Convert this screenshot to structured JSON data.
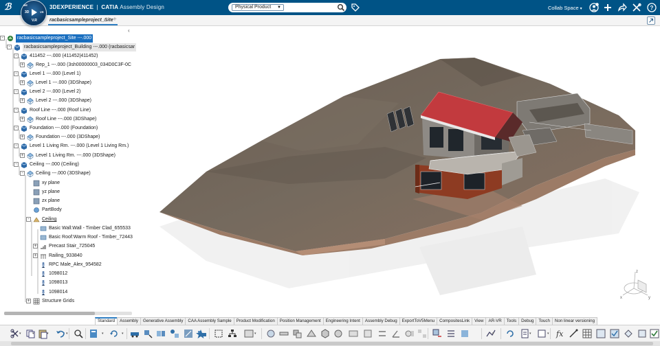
{
  "app": {
    "brand": "3DEXPERIENCE",
    "separator": "|",
    "product": "CATIA",
    "app_name": "Assembly Design",
    "compass": {
      "top": "ME",
      "left": "3D",
      "right": "VR",
      "bottom": "V.R"
    }
  },
  "search": {
    "scope": "Physical Product",
    "placeholder": ""
  },
  "header": {
    "collab_space": "Collab Space"
  },
  "tabs": {
    "document": "racbasicsampleproject_Site",
    "close": "×",
    "add": "+"
  },
  "tree": {
    "collapse_glyph": "‹",
    "items": [
      {
        "label": "racbasicsampleproject_Site ---.000"
      },
      {
        "label": "racbasicsampleproject_Building ---.000 (racbasicsar"
      },
      {
        "label": "411452 ---.000 (411452|411452)"
      },
      {
        "label": "Rep_1 ---.000 (3sh00000003_034D0C3F-0C"
      },
      {
        "label": "Level 1 ---.000 (Level 1)"
      },
      {
        "label": "Level 1 ---.000 (3DShape)"
      },
      {
        "label": "Level 2 ---.000 (Level 2)"
      },
      {
        "label": "Level 2 ---.000 (3DShape)"
      },
      {
        "label": "Roof Line ---.000 (Roof Line)"
      },
      {
        "label": "Roof Line ---.000 (3DShape)"
      },
      {
        "label": "Foundation ---.000 (Foundation)"
      },
      {
        "label": "Foundation ---.000 (3DShape)"
      },
      {
        "label": "Level 1 Living Rm. ---.000 (Level 1 Living Rm.)"
      },
      {
        "label": "Level 1 Living Rm. ---.000 (3DShape)"
      },
      {
        "label": "Ceiling ---.000 (Ceiling)"
      },
      {
        "label": "Ceiling ---.000 (3DShape)"
      },
      {
        "label": "xy plane"
      },
      {
        "label": "yz plane"
      },
      {
        "label": "zx plane"
      },
      {
        "label": "PartBody"
      },
      {
        "label": "Ceiling"
      },
      {
        "label": "Basic Wall:Wall - Timber Clad_655533"
      },
      {
        "label": "Basic Roof:Warm Roof - Timber_72443"
      },
      {
        "label": "Precast Stair_725045"
      },
      {
        "label": "Railing_933840"
      },
      {
        "label": "RPC Male_Alex_954582"
      },
      {
        "label": "1098012"
      },
      {
        "label": "1098013"
      },
      {
        "label": "1098014"
      },
      {
        "label": "Structure Grids"
      }
    ]
  },
  "axis": {
    "x": "x",
    "y": "y",
    "z": "z"
  },
  "section_tabs": [
    "Standard",
    "Assembly",
    "Generative Assembly",
    "CAA Assembly Sample",
    "Product Modification",
    "Position Management",
    "Engineering Intent",
    "Assembly Debug",
    "ExportToV5Menu",
    "CompositesLink",
    "View",
    "AR-VR",
    "Tools",
    "Debug",
    "Touch",
    "Non linear versioning"
  ],
  "active_section": "Standard",
  "colors": {
    "topbar": "#005386",
    "selection": "#1a6fc0",
    "roof": "#c23a3e",
    "terrain": "#7a6c5e"
  }
}
